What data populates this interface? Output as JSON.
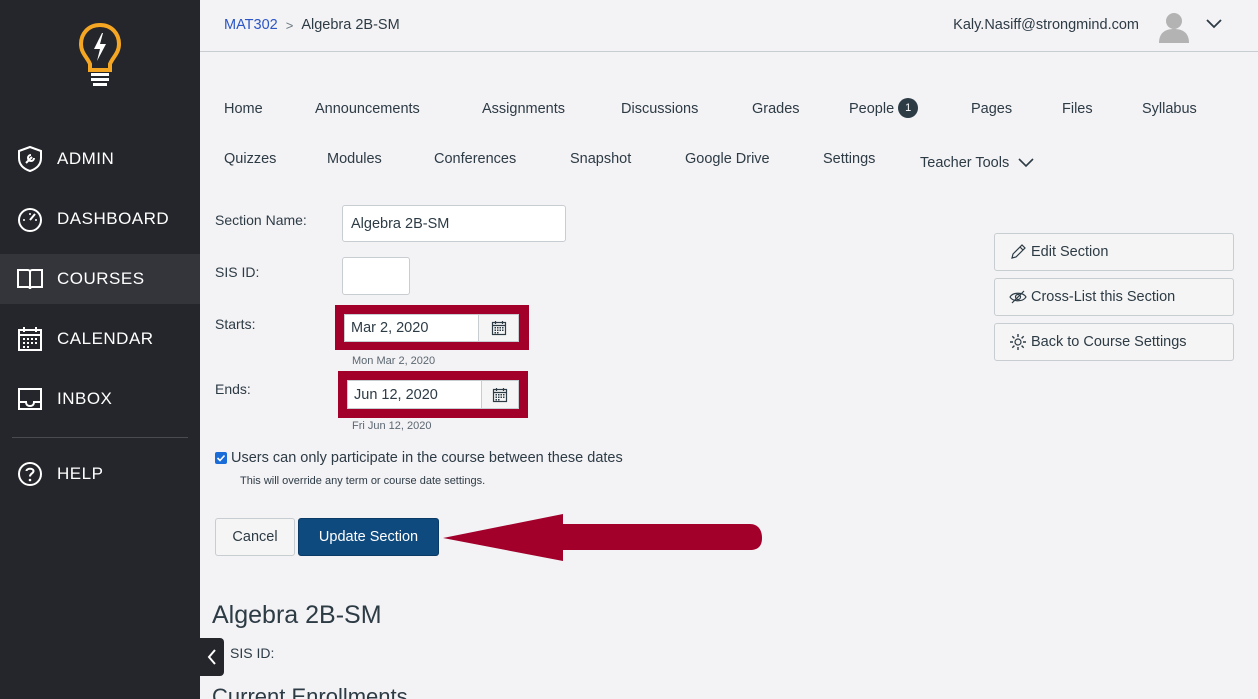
{
  "sidebar": {
    "items": [
      {
        "label": "ADMIN",
        "icon": "admin-shield-icon"
      },
      {
        "label": "DASHBOARD",
        "icon": "speedometer-icon"
      },
      {
        "label": "COURSES",
        "icon": "book-icon"
      },
      {
        "label": "CALENDAR",
        "icon": "calendar-icon"
      },
      {
        "label": "INBOX",
        "icon": "inbox-icon"
      },
      {
        "label": "HELP",
        "icon": "help-icon"
      }
    ],
    "active": "COURSES"
  },
  "header": {
    "breadcrumb": {
      "course": "MAT302",
      "separator": ">",
      "current": "Algebra 2B-SM"
    },
    "user_email": "Kaly.Nasiff@strongmind.com"
  },
  "tabs": {
    "row1": [
      "Home",
      "Announcements",
      "Assignments",
      "Discussions",
      "Grades",
      "People",
      "Pages",
      "Files",
      "Syllabus"
    ],
    "people_badge": "1",
    "row2": [
      "Quizzes",
      "Modules",
      "Conferences",
      "Snapshot",
      "Google Drive",
      "Settings",
      "Teacher Tools"
    ]
  },
  "form": {
    "section_name_label": "Section Name:",
    "section_name_value": "Algebra 2B-SM",
    "sis_id_label": "SIS ID:",
    "sis_id_value": "",
    "starts_label": "Starts:",
    "starts_value": "Mar 2, 2020",
    "starts_hint": "Mon Mar 2, 2020",
    "ends_label": "Ends:",
    "ends_value": "Jun 12, 2020",
    "ends_hint": "Fri Jun 12, 2020",
    "restrict_label": "Users can only participate in the course between these dates",
    "restrict_checked": true,
    "restrict_note": "This will override any term or course date settings.",
    "cancel_label": "Cancel",
    "update_label": "Update Section"
  },
  "side_actions": {
    "edit": "Edit Section",
    "crosslist": "Cross-List this Section",
    "back": "Back to Course Settings"
  },
  "section": {
    "title": "Algebra 2B-SM",
    "sis_label": "SIS ID:",
    "enrollments_title": "Current Enrollments"
  },
  "colors": {
    "sidebar_bg": "#25262b",
    "accent_red": "#a2002b",
    "primary_button": "#0e4a7e",
    "link_blue": "#2a56c6"
  }
}
